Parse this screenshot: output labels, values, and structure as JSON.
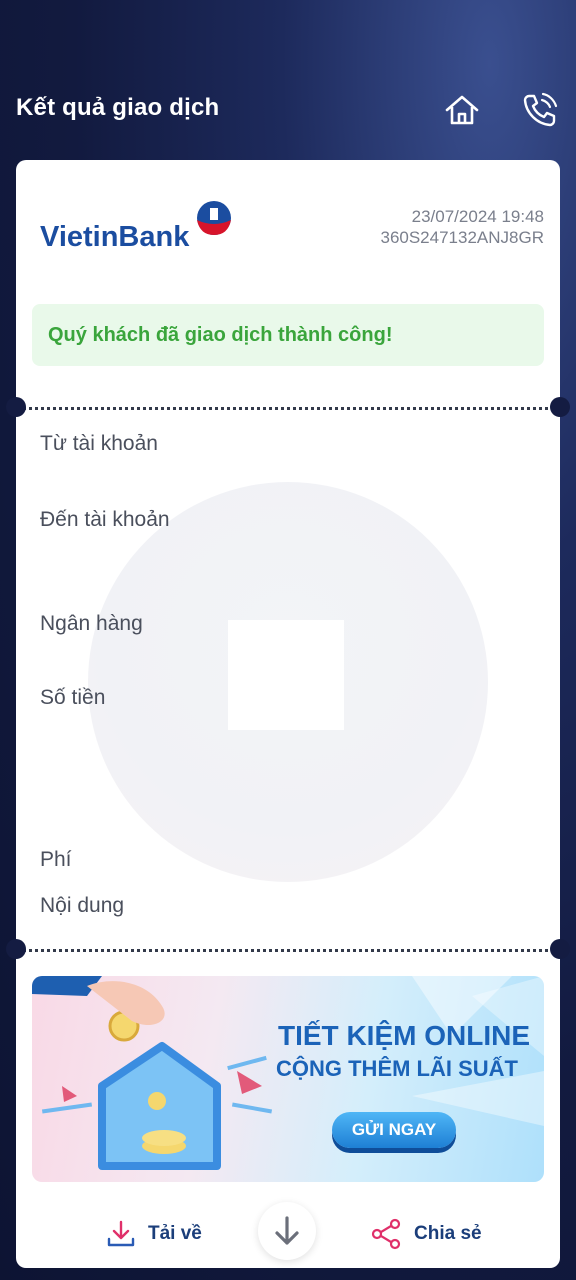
{
  "header": {
    "title": "Kết quả giao dịch",
    "icons": [
      "home-icon",
      "phone-icon"
    ]
  },
  "receipt": {
    "bank_logo_text": "VietinBank",
    "datetime": "23/07/2024 19:48",
    "transaction_code": "360S247132ANJ8GR",
    "success_message": "Quý khách đã giao dịch thành công!",
    "fields": {
      "from_account": "Từ tài khoản",
      "to_account": "Đến tài khoản",
      "bank": "Ngân hàng",
      "amount": "Số tiền",
      "fee": "Phí",
      "content": "Nội dung"
    }
  },
  "banner": {
    "line1": "TIẾT KIỆM ONLINE",
    "line2": "CỘNG THÊM LÃI SUẤT",
    "button": "GỬI NGAY"
  },
  "actions": {
    "download": "Tải về",
    "share": "Chia sẻ"
  },
  "colors": {
    "success_text": "#3aa53c",
    "success_bg": "#e9f9ea",
    "brand_blue": "#1b63b8",
    "brand_red": "#d7142b",
    "action_text": "#1b3e7a"
  }
}
